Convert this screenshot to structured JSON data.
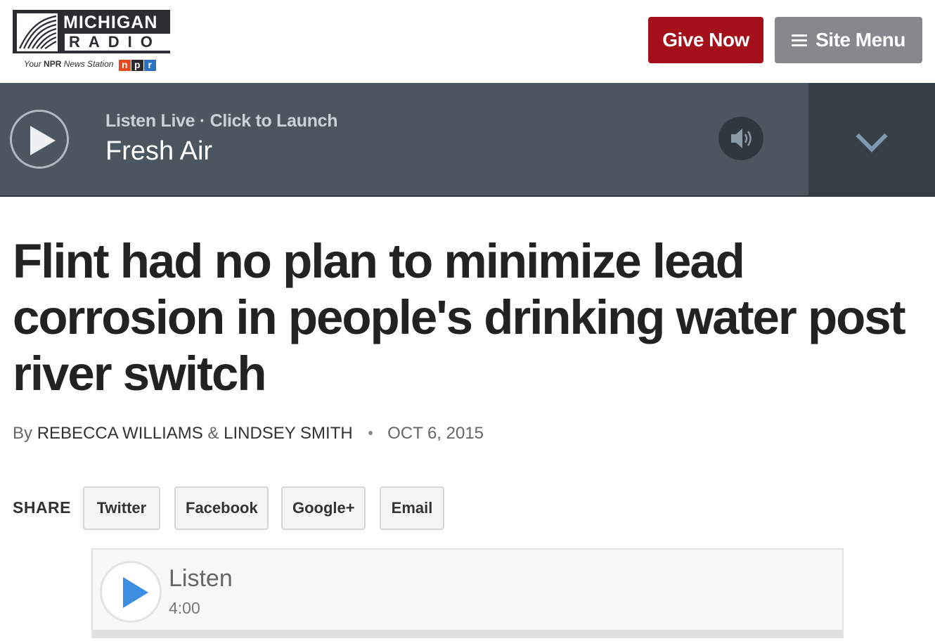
{
  "header": {
    "logo": {
      "line1": "MICHIGAN",
      "line2": "RADIO",
      "tagline_pre": "Your",
      "tagline_brand": "NPR",
      "tagline_post": "News Station",
      "npr_letters": [
        "n",
        "p",
        "r"
      ]
    },
    "give_label": "Give Now",
    "menu_label": "Site Menu",
    "colors": {
      "give": "#a3101a",
      "menu": "#85888c"
    }
  },
  "player": {
    "status": "Listen Live · Click to Launch",
    "program": "Fresh Air",
    "icons": {
      "play": "play-circle-icon",
      "volume": "speaker-icon",
      "expand": "chevron-down-icon"
    }
  },
  "article": {
    "headline": "Flint had no plan to minimize lead corrosion in people's drinking water post river switch",
    "byline": {
      "prefix": "By",
      "author1": "REBECCA WILLIAMS",
      "amp": "&",
      "author2": "LINDSEY SMITH",
      "date": "OCT 6, 2015"
    },
    "share": {
      "label": "SHARE",
      "buttons": [
        "Twitter",
        "Facebook",
        "Google+",
        "Email"
      ]
    },
    "audio": {
      "title": "Listen",
      "duration": "4:00",
      "accent": "#3d8ee0"
    }
  }
}
